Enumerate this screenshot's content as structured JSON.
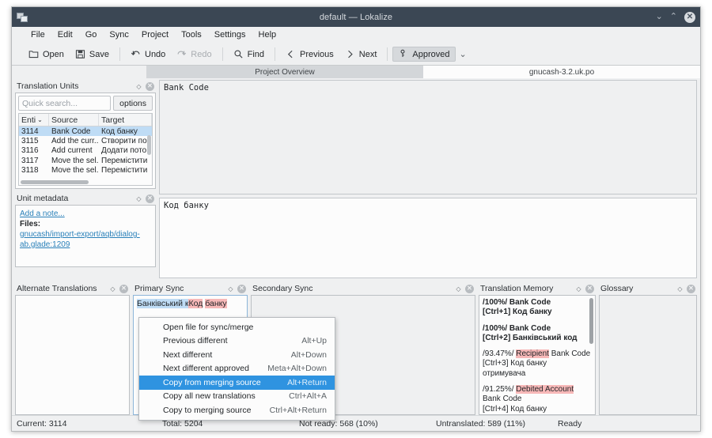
{
  "window": {
    "title": "default — Lokalize",
    "app_icon": "documents-icon",
    "controls": {
      "minimize": "⌄",
      "maximize": "⌃",
      "close": "✕"
    }
  },
  "menubar": {
    "items": [
      {
        "label": "File"
      },
      {
        "label": "Edit"
      },
      {
        "label": "Go"
      },
      {
        "label": "Sync"
      },
      {
        "label": "Project"
      },
      {
        "label": "Tools"
      },
      {
        "label": "Settings"
      },
      {
        "label": "Help"
      }
    ]
  },
  "toolbar": {
    "open": "Open",
    "save": "Save",
    "undo": "Undo",
    "redo": "Redo",
    "find": "Find",
    "previous": "Previous",
    "next": "Next",
    "approved": "Approved",
    "approved_arrow": "⌄"
  },
  "tabs": [
    {
      "label": "Project Overview",
      "active": false
    },
    {
      "label": "gnucash-3.2.uk.po",
      "active": true
    }
  ],
  "translation_units": {
    "title": "Translation Units",
    "search_placeholder": "Quick search...",
    "search_value": "",
    "options_label": "options",
    "columns": [
      "Enti",
      "Source",
      "Target"
    ],
    "sort_arrow": "⌄",
    "rows": [
      {
        "entry": "3114",
        "source": "Bank Code",
        "target": "Код банку",
        "selected": true
      },
      {
        "entry": "3115",
        "source": "Add the curr...",
        "target": "Створити по",
        "selected": false
      },
      {
        "entry": "3116",
        "source": "Add current",
        "target": "Додати пото",
        "selected": false
      },
      {
        "entry": "3117",
        "source": "Move the sel...",
        "target": "Перемістити",
        "selected": false
      },
      {
        "entry": "3118",
        "source": "Move the sel...",
        "target": "Перемістити",
        "selected": false
      }
    ]
  },
  "unit_metadata": {
    "title": "Unit metadata",
    "add_note": "Add a note...",
    "files_label": "Files:",
    "file_path": "gnucash/import-export/aqb/dialog-ab.glade:1209"
  },
  "editor": {
    "source_text": "Bank  Code",
    "target_text": "Код  банку"
  },
  "alternate_translations": {
    "title": "Alternate Translations",
    "content": ""
  },
  "primary_sync": {
    "title": "Primary Sync",
    "segments": [
      {
        "text": "Банківський к",
        "style": "blue"
      },
      {
        "text": "Код",
        "style": "red"
      },
      {
        "text": " ",
        "style": "plain"
      },
      {
        "text": "банку",
        "style": "red"
      }
    ]
  },
  "secondary_sync": {
    "title": "Secondary Sync",
    "content": ""
  },
  "translation_memory": {
    "title": "Translation Memory",
    "entries": [
      {
        "percent": "/100%/",
        "source_parts": [
          {
            "text": " Bank Code",
            "highlight": false
          }
        ],
        "translation": "[Ctrl+1] Код банку"
      },
      {
        "percent": "/100%/",
        "source_parts": [
          {
            "text": " Bank Code",
            "highlight": false
          }
        ],
        "translation": "[Ctrl+2] Банківський код"
      },
      {
        "percent": "/93.47%/",
        "source_parts": [
          {
            "text": "Recipient",
            "highlight": true
          },
          {
            "text": " Bank Code",
            "highlight": false
          }
        ],
        "translation": "[Ctrl+3] Код банку отримувача"
      },
      {
        "percent": "/91.25%/",
        "source_parts": [
          {
            "text": "Debited Account",
            "highlight": true
          },
          {
            "text": " Bank Code",
            "highlight": false
          }
        ],
        "translation": "[Ctrl+4] Код банку"
      }
    ]
  },
  "glossary": {
    "title": "Glossary",
    "content": ""
  },
  "context_menu": {
    "items": [
      {
        "label": "Open file for sync/merge",
        "shortcut": "",
        "highlighted": false
      },
      {
        "label": "Previous different",
        "shortcut": "Alt+Up",
        "highlighted": false
      },
      {
        "label": "Next different",
        "shortcut": "Alt+Down",
        "highlighted": false
      },
      {
        "label": "Next different approved",
        "shortcut": "Meta+Alt+Down",
        "highlighted": false
      },
      {
        "label": "Copy from merging source",
        "shortcut": "Alt+Return",
        "highlighted": true
      },
      {
        "label": "Copy all new translations",
        "shortcut": "Ctrl+Alt+A",
        "highlighted": false
      },
      {
        "label": "Copy to merging source",
        "shortcut": "Ctrl+Alt+Return",
        "highlighted": false
      }
    ]
  },
  "statusbar": {
    "current": "Current: 3114",
    "total": "Total: 5204",
    "not_ready": "Not ready: 568 (10%)",
    "untranslated": "Untranslated: 589 (11%)",
    "state": "Ready"
  },
  "colors": {
    "titlebar": "#3b4754",
    "chrome": "#eff0f1",
    "selection_blue": "#bfdcf5",
    "menu_highlight": "#2f93e0",
    "diff_red": "#f7b8b8",
    "link": "#2980b9"
  }
}
